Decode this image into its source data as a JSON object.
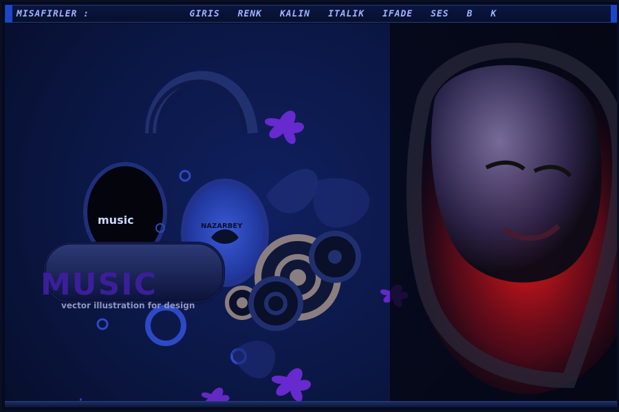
{
  "topbar": {
    "title": "MISAFIRLER :",
    "menu": [
      "GIRIS",
      "RENK",
      "KALIN",
      "ITALIK",
      "IFADE",
      "SES",
      "B",
      "K"
    ]
  },
  "art": {
    "music_big": "MUSIC",
    "music_tagline": "vector illustration for design",
    "left_cup_text": "music",
    "right_cup_text": "NAZARBEY",
    "bottom_logo": "music"
  },
  "colors": {
    "background": "#0a153f",
    "menu_text": "#9fb3ff",
    "accent": "#1b46c9",
    "red_glow": "#ff1a1a"
  }
}
